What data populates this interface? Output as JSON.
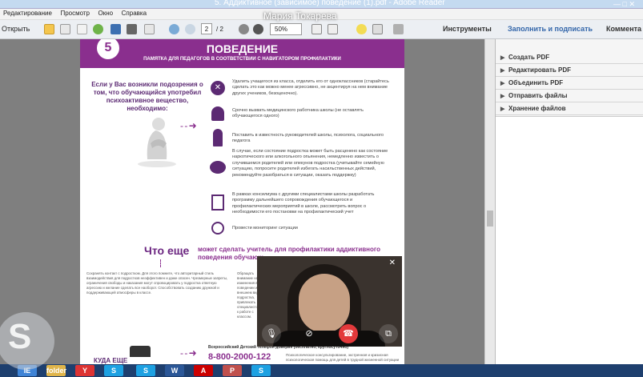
{
  "window": {
    "title": "5. Аддиктивное (зависимое) поведение (1).pdf - Adobe Reader",
    "controls": "— □ ✕"
  },
  "overlay": {
    "caller_name": "Мария Токарева"
  },
  "menu": {
    "items": [
      "Редактирование",
      "Просмотр",
      "Окно",
      "Справка"
    ]
  },
  "toolbar": {
    "open_label": "Открыть",
    "page_current": "2",
    "page_total": "/ 2",
    "zoom": "50%",
    "tools": "Инструменты",
    "fill_sign": "Заполнить и подписать",
    "comment": "Коммента"
  },
  "side_panel": {
    "items": [
      "Создать PDF",
      "Редактировать PDF",
      "Объединить PDF",
      "Отправить файлы",
      "Хранение файлов"
    ]
  },
  "document": {
    "badge": "5",
    "header_title": "ПОВЕДЕНИЕ",
    "header_sub": "ПАМЯТКА ДЛЯ ПЕДАГОГОВ В СООТВЕТСТВИИ С НАВИГАТОРОМ ПРОФИЛАКТИКИ",
    "question": "Если у Вас возникли подозрения о том, что обучающийся употребил психоактивное вещество, необходимо:",
    "steps": [
      "Удалить учащегося из класса, отделить его от одноклассников (старайтесь сделать это как можно менее агрессивно, не акцентируя на нем внимание других учеников, безоценочно).",
      "Срочно вызвать медицинского работника школы (не оставлять обучающегося одного)",
      "Поставить в известность руководителей школы, психолога, социального педагога",
      "В случае, если состояние подростка может быть расценено как состояние наркотического или алкогольного опьянения, немедленно известить о случившемся родителей или опекунов подростка (учитывайте семейную ситуацию, попросите родителей избегать насильственных действий, рекомендуйте разобраться в ситуации, оказать поддержку)",
      "В рамках консилиума с другими специалистами школы разработать программу дальнейшего сопровождения обучающегося и профилактических мероприятий в школе, рассмотреть вопрос о необходимости его постановки на профилактический учет",
      "Провести мониторинг ситуации"
    ],
    "what_else_title": "Что еще",
    "what_else_sub": "может сделать учитель для профилактики аддиктивного поведения обучающ",
    "bottom_left_text": "Сохранять контакт с подростком. Для этого помните, что авторитарный стиль взаимодействия для подростков неэффективен и даже опасен. Чрезмерные запреты, ограничения свободы и наказания могут спровоцировать у подростка ответную агрессию и желание сделать все наоборот. Способствовать созданию дружной и поддерживающей атмосферы в классе.",
    "bottom_right_text": "Обращать внимание на изменения в поведении и внешнем виде подростка, привлекать специалистов к работе с классом.",
    "footer_left": "КУДА ЕЩЕ",
    "hotline_label": "Всероссийский Детский телефон доверия (бесплатно, круглосуточно)",
    "hotline_number": "8-800-2000-122",
    "hotline_note": "Психологическое консультирование, экстренная и кризисная психологическая помощь для детей в трудной жизненной ситуации"
  },
  "taskbar": {
    "items": [
      "IE",
      "folder",
      "Y",
      "S",
      "S",
      "W",
      "A",
      "P",
      "S"
    ]
  },
  "colors": {
    "accent": "#8a2f8e",
    "toolbar_bg": "#eceff3",
    "taskbar": "#1e3f6e",
    "video_end": "#e3393b"
  }
}
